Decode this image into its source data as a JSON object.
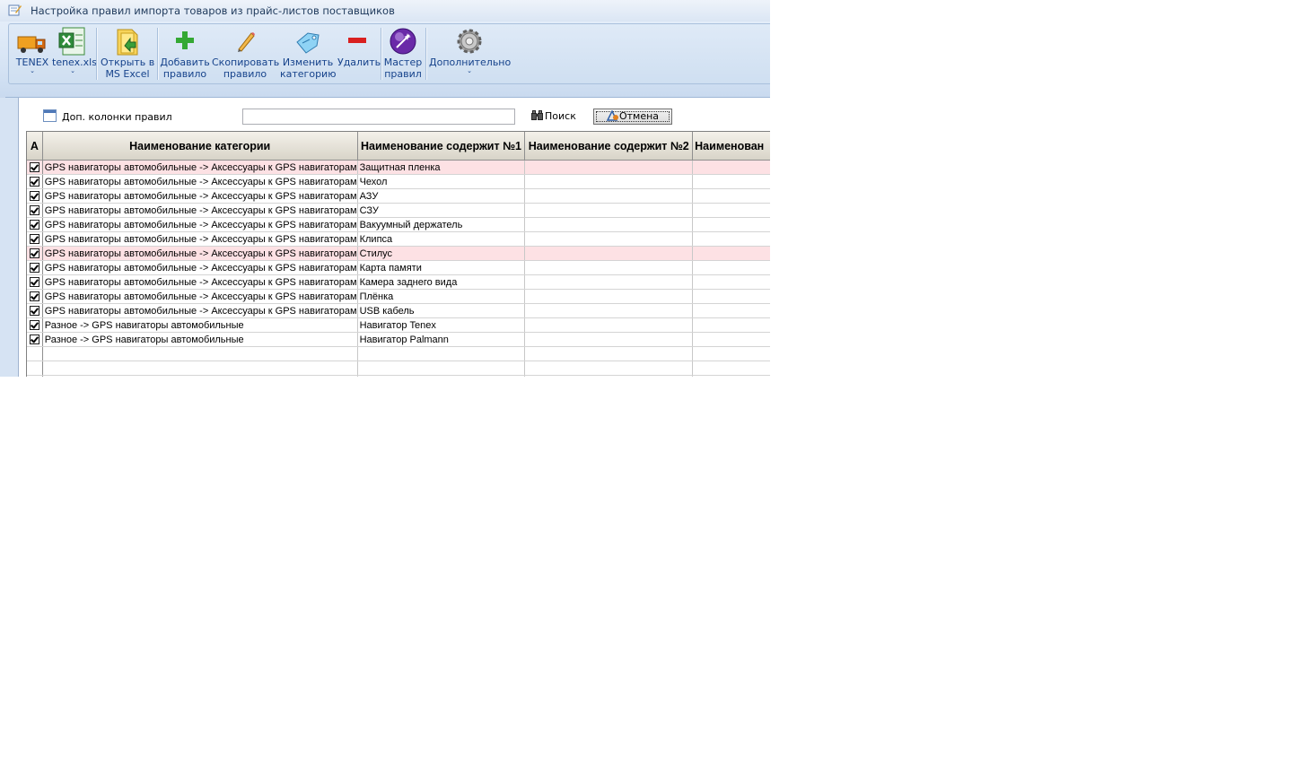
{
  "window": {
    "title": "Настройка правил импорта товаров из прайс-листов поставщиков"
  },
  "toolbar": {
    "buttons": [
      {
        "label": "TENEX",
        "label2": "",
        "has_dropdown": true,
        "icon": "truck-icon"
      },
      {
        "label": "tenex.xls",
        "label2": "",
        "has_dropdown": true,
        "icon": "excel-icon"
      },
      {
        "label": "Открыть в",
        "label2": "MS Excel",
        "has_dropdown": false,
        "icon": "folder-icon"
      },
      {
        "label": "Добавить",
        "label2": "правило",
        "has_dropdown": false,
        "icon": "plus-icon"
      },
      {
        "label": "Скопировать",
        "label2": "правило",
        "has_dropdown": false,
        "icon": "pencil-icon"
      },
      {
        "label": "Изменить",
        "label2": "категорию",
        "has_dropdown": false,
        "icon": "tag-icon"
      },
      {
        "label": "Удалить",
        "label2": "",
        "has_dropdown": false,
        "icon": "minus-icon"
      },
      {
        "label": "Мастер",
        "label2": "правил",
        "has_dropdown": false,
        "icon": "wizard-icon"
      },
      {
        "label": "Дополнительно",
        "label2": "",
        "has_dropdown": true,
        "icon": "gear-icon"
      }
    ],
    "dropdown_glyph": "⌄"
  },
  "filter": {
    "extra_columns_label": "Доп. колонки правил",
    "search_value": "",
    "search_label": "Поиск",
    "cancel_label": "Отмена"
  },
  "grid": {
    "columns": [
      "A",
      "Наименование категории",
      "Наименование содержит №1",
      "Наименование содержит №2",
      "Наименован"
    ],
    "rows": [
      {
        "checked": true,
        "category": "GPS навигаторы автомобильные -> Аксессуары к GPS навигаторам",
        "c1": "Защитная пленка",
        "c2": "",
        "c3": "",
        "highlight": true
      },
      {
        "checked": true,
        "category": "GPS навигаторы автомобильные -> Аксессуары к GPS навигаторам",
        "c1": "Чехол",
        "c2": "",
        "c3": "",
        "highlight": false
      },
      {
        "checked": true,
        "category": "GPS навигаторы автомобильные -> Аксессуары к GPS навигаторам",
        "c1": "АЗУ",
        "c2": "",
        "c3": "",
        "highlight": false
      },
      {
        "checked": true,
        "category": "GPS навигаторы автомобильные -> Аксессуары к GPS навигаторам",
        "c1": "СЗУ",
        "c2": "",
        "c3": "",
        "highlight": false
      },
      {
        "checked": true,
        "category": "GPS навигаторы автомобильные -> Аксессуары к GPS навигаторам",
        "c1": "Вакуумный держатель",
        "c2": "",
        "c3": "",
        "highlight": false
      },
      {
        "checked": true,
        "category": "GPS навигаторы автомобильные -> Аксессуары к GPS навигаторам",
        "c1": "Клипса",
        "c2": "",
        "c3": "",
        "highlight": false
      },
      {
        "checked": true,
        "category": "GPS навигаторы автомобильные -> Аксессуары к GPS навигаторам",
        "c1": "Стилус",
        "c2": "",
        "c3": "",
        "highlight": true
      },
      {
        "checked": true,
        "category": "GPS навигаторы автомобильные -> Аксессуары к GPS навигаторам",
        "c1": "Карта памяти",
        "c2": "",
        "c3": "",
        "highlight": false
      },
      {
        "checked": true,
        "category": "GPS навигаторы автомобильные -> Аксессуары к GPS навигаторам",
        "c1": "Камера заднего вида",
        "c2": "",
        "c3": "",
        "highlight": false
      },
      {
        "checked": true,
        "category": "GPS навигаторы автомобильные -> Аксессуары к GPS навигаторам",
        "c1": "Плёнка",
        "c2": "",
        "c3": "",
        "highlight": false
      },
      {
        "checked": true,
        "category": "GPS навигаторы автомобильные -> Аксессуары к GPS навигаторам",
        "c1": "USB кабель",
        "c2": "",
        "c3": "",
        "highlight": false
      },
      {
        "checked": true,
        "category": "Разное -> GPS навигаторы автомобильные",
        "c1": "Навигатор Tenex",
        "c2": "",
        "c3": "",
        "highlight": false
      },
      {
        "checked": true,
        "category": "Разное -> GPS навигаторы автомобильные",
        "c1": "Навигатор Palmann",
        "c2": "",
        "c3": "",
        "highlight": false
      },
      {
        "checked": false,
        "category": "",
        "c1": "",
        "c2": "",
        "c3": "",
        "highlight": false
      },
      {
        "checked": false,
        "category": "",
        "c1": "",
        "c2": "",
        "c3": "",
        "highlight": false
      },
      {
        "checked": false,
        "category": "",
        "c1": "",
        "c2": "",
        "c3": "",
        "highlight": false
      }
    ]
  },
  "colors": {
    "highlight_row": "#fde1e4",
    "ribbon_text": "#15428b",
    "title_text": "#1e395b"
  }
}
